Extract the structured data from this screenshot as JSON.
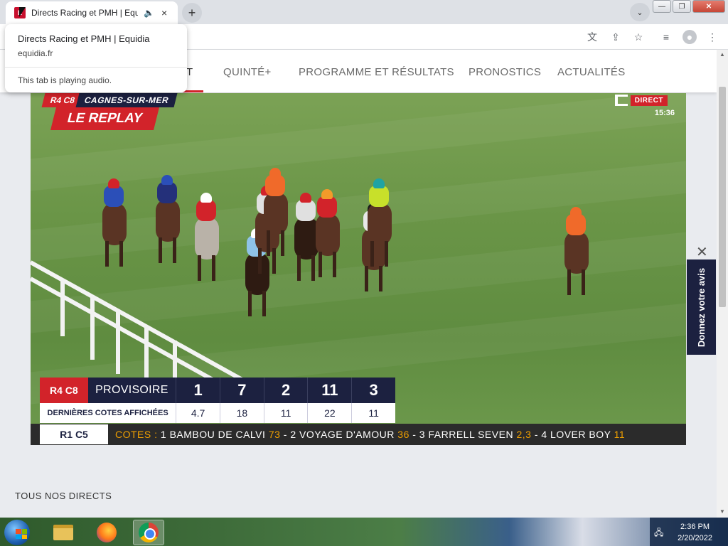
{
  "browser": {
    "tab_title": "Directs Racing et PMH | Equidia",
    "tab_audio_icon": "speaker-icon",
    "close_glyph": "×",
    "new_tab_glyph": "+",
    "tab_search_glyph": "⌄",
    "favicon_text": "E",
    "window_buttons": {
      "minimize": "—",
      "maximize": "❐",
      "close": "✕"
    },
    "toolbar_icons": [
      "translate-icon",
      "share-icon",
      "star-icon",
      "media-controls-icon",
      "profile-icon",
      "menu-icon"
    ],
    "toolbar_glyphs": [
      "文",
      "⇪",
      "☆",
      "≡",
      "●",
      "⋮"
    ]
  },
  "hovercard": {
    "title": "Directs Racing et PMH | Equidia",
    "domain": "equidia.fr",
    "audio_note": "This tab is playing audio."
  },
  "nav": {
    "items": [
      "T",
      "QUINTÉ+",
      "PROGRAMME ET RÉSULTATS",
      "PRONOSTICS",
      "ACTUALITÉS"
    ]
  },
  "video": {
    "race_code": "R4 C8",
    "location": "CAGNES-SUR-MER",
    "replay_label": "LE REPLAY",
    "live_badge": "DIRECT",
    "time": "15:36",
    "board": {
      "code": "R4 C8",
      "status": "PROVISOIRE",
      "arrivals": [
        "1",
        "7",
        "2",
        "11",
        "3"
      ],
      "odds_label": "DERNIÈRES COTES AFFICHÉES",
      "odds": [
        "4.7",
        "18",
        "11",
        "22",
        "11"
      ]
    },
    "ticker": {
      "race": "R1 C5",
      "prefix": "COTES :",
      "entries": [
        {
          "name": "1 BAMBOU DE CALVI",
          "odd": "73"
        },
        {
          "name": " - 2 VOYAGE D'AMOUR",
          "odd": "36"
        },
        {
          "name": " - 3 FARRELL SEVEN",
          "odd": "2,3"
        },
        {
          "name": " - 4 LOVER BOY",
          "odd": "11"
        }
      ]
    }
  },
  "feedback": {
    "label": "Donnez votre avis",
    "close": "✕"
  },
  "section_title": "TOUS NOS DIRECTS",
  "taskbar": {
    "apps": [
      "start-button",
      "file-explorer-icon",
      "firefox-icon",
      "chrome-icon"
    ],
    "time": "2:36 PM",
    "date": "2/20/2022"
  },
  "colors": {
    "accent_red": "#d2232a",
    "navy": "#1c2140",
    "ticker_orange": "#f0a000"
  }
}
